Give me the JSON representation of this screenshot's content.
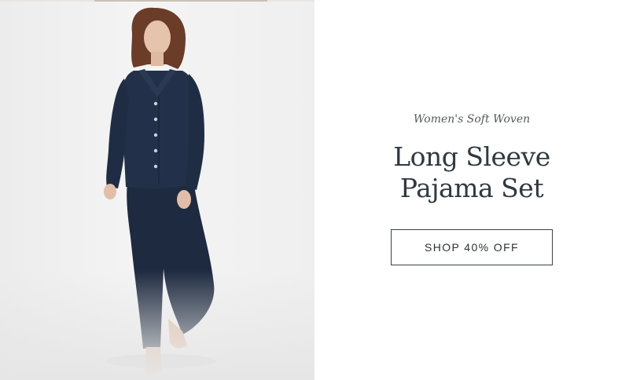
{
  "hero": {
    "eyebrow": "Women's Soft Woven",
    "title_line1": "Long Sleeve",
    "title_line2": "Pajama Set",
    "cta_label": "SHOP 40% OFF"
  },
  "colors": {
    "pajama_navy": "#1f2c42",
    "text_dark": "#2f3a40",
    "button_border": "#3a4146",
    "photo_background": "#efefef"
  }
}
